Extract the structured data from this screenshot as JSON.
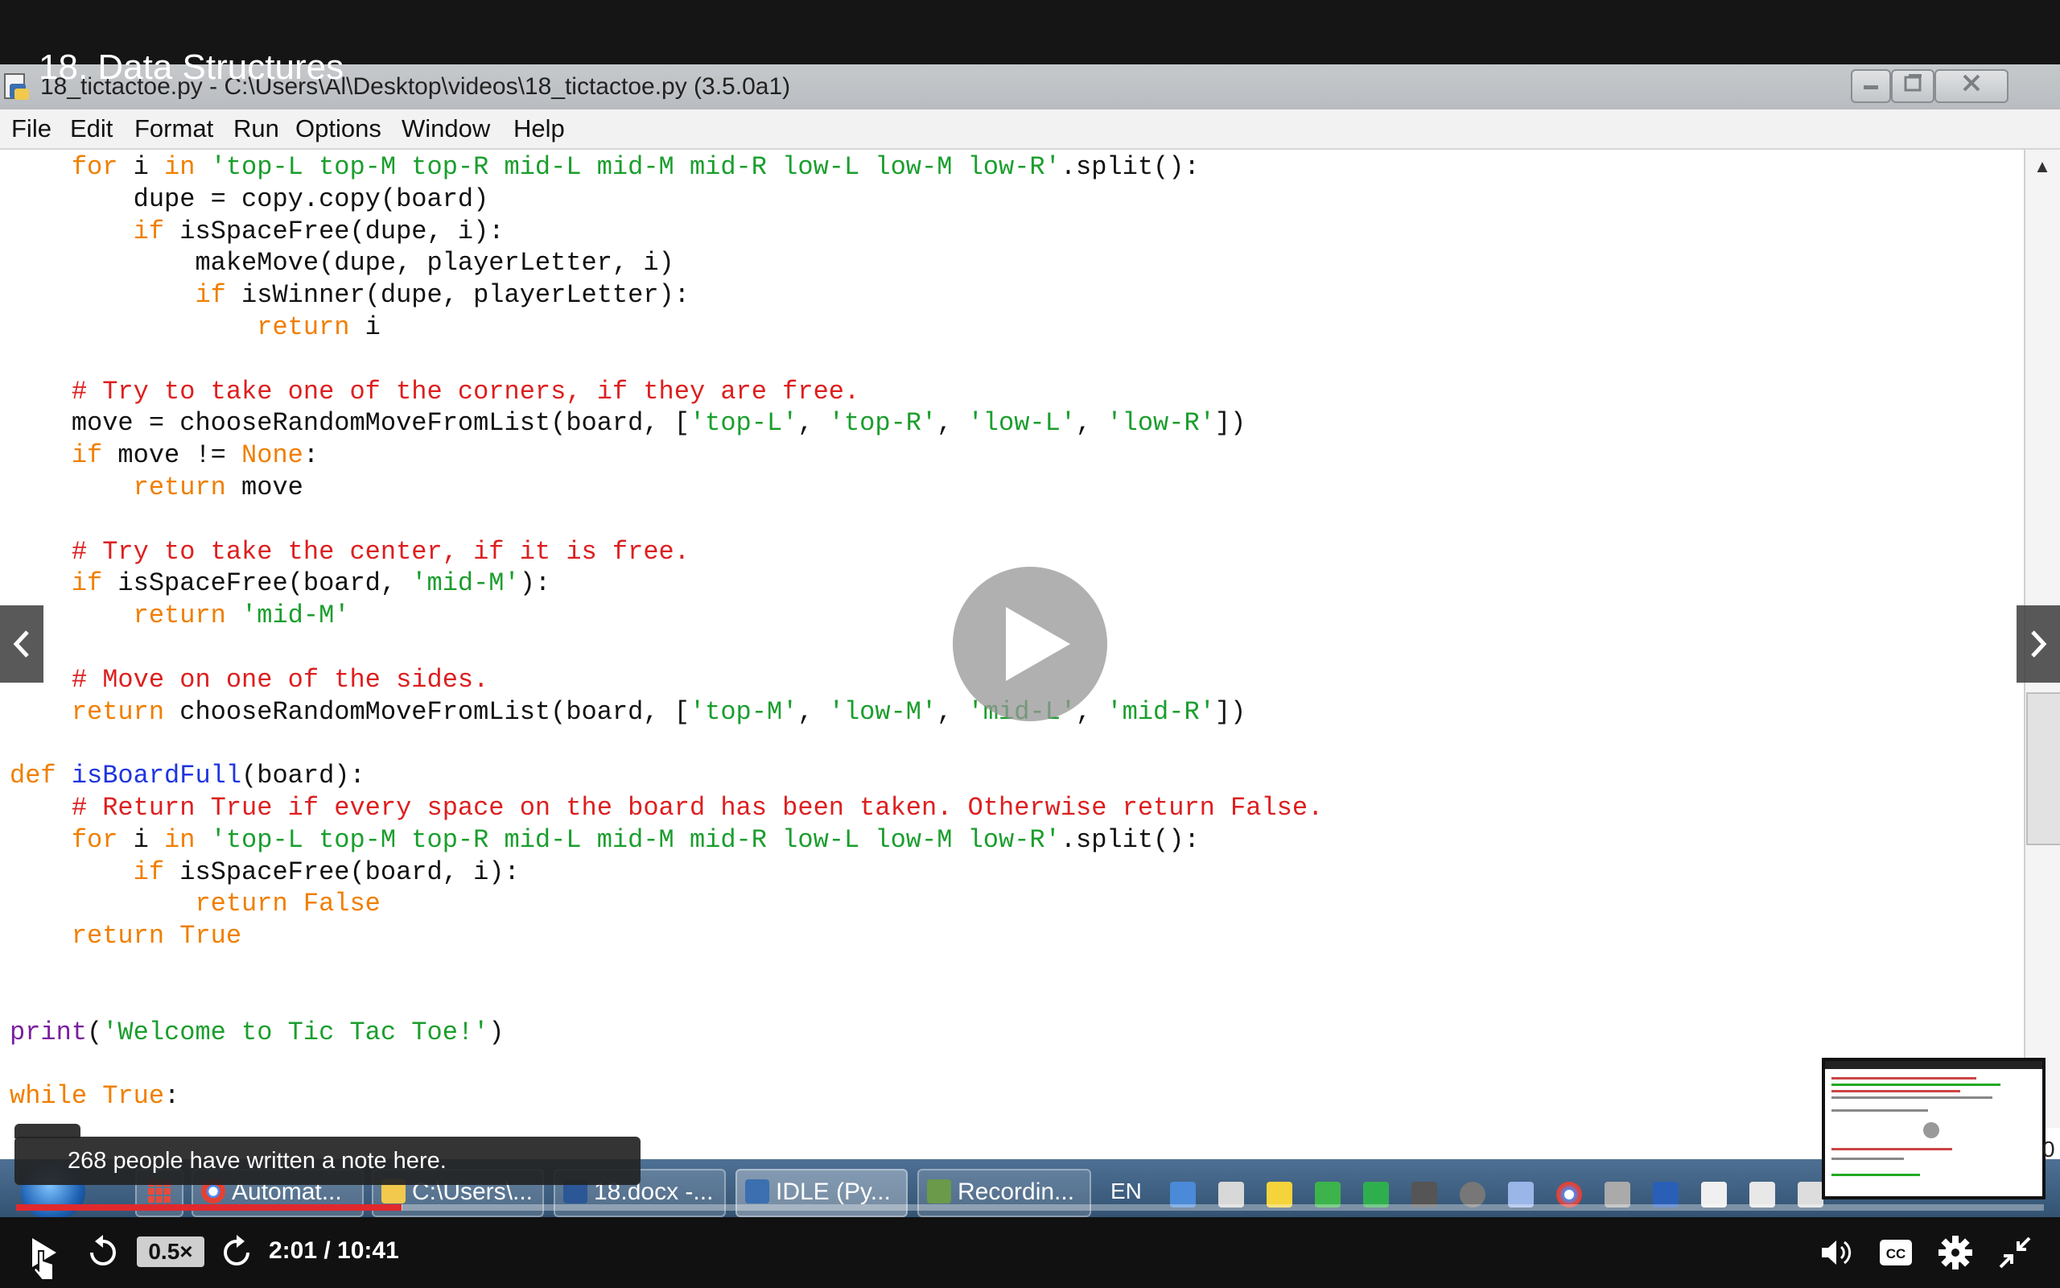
{
  "video": {
    "title": "18. Data Structures",
    "note_tooltip": "268 people have written a note here.",
    "playback": {
      "speed": "0.5×",
      "time_display": "2:01 / 10:41",
      "progress_fraction": 0.19
    },
    "thumbnail_counter": "0"
  },
  "idle_window": {
    "title": "18_tictactoe.py - C:\\Users\\Al\\Desktop\\videos\\18_tictactoe.py (3.5.0a1)",
    "menu": [
      "File",
      "Edit",
      "Format",
      "Run",
      "Options",
      "Window",
      "Help"
    ],
    "code_lines": [
      "    for i in 'top-L top-M top-R mid-L mid-M mid-R low-L low-M low-R'.split():",
      "        dupe = copy.copy(board)",
      "        if isSpaceFree(dupe, i):",
      "            makeMove(dupe, playerLetter, i)",
      "            if isWinner(dupe, playerLetter):",
      "                return i",
      "",
      "    # Try to take one of the corners, if they are free.",
      "    move = chooseRandomMoveFromList(board, ['top-L', 'top-R', 'low-L', 'low-R'])",
      "    if move != None:",
      "        return move",
      "",
      "    # Try to take the center, if it is free.",
      "    if isSpaceFree(board, 'mid-M'):",
      "        return 'mid-M'",
      "",
      "    # Move on one of the sides.",
      "    return chooseRandomMoveFromList(board, ['top-M', 'low-M', 'mid-L', 'mid-R'])",
      "",
      "def isBoardFull(board):",
      "    # Return True if every space on the board has been taken. Otherwise return False.",
      "    for i in 'top-L top-M top-R mid-L mid-M mid-R low-L low-M low-R'.split():",
      "        if isSpaceFree(board, i):",
      "            return False",
      "    return True",
      "",
      "",
      "print('Welcome to Tic Tac Toe!')",
      "",
      "while True:"
    ]
  },
  "taskbar": {
    "buttons": [
      "Automat...",
      "C:\\Users\\...",
      "18.docx -...",
      "IDLE (Py...",
      "Recordin..."
    ],
    "language": "EN"
  },
  "colors": {
    "keyword": "#f07f00",
    "string": "#1a9e2d",
    "comment": "#dd1f1f",
    "definition": "#1f35e0",
    "progress": "#e0292d"
  }
}
